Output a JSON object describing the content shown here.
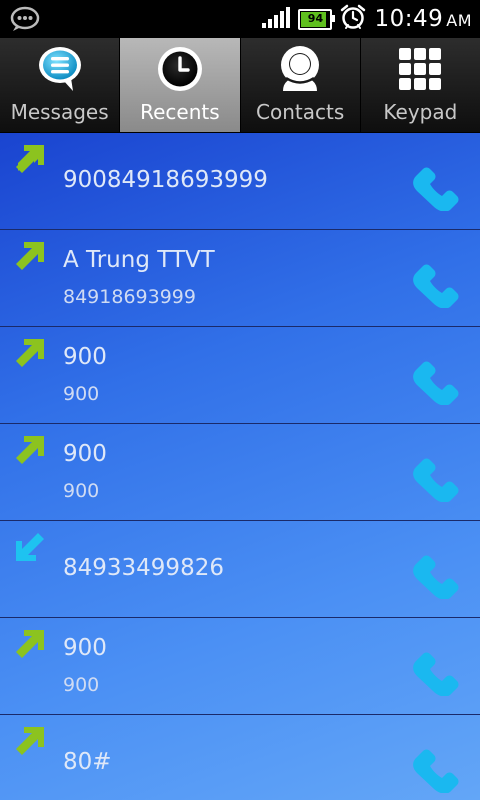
{
  "status_bar": {
    "battery_level": "94",
    "time": "10:49",
    "ampm": "AM",
    "icons": [
      "notification-icon",
      "signal-icon",
      "battery-icon",
      "alarm-icon"
    ]
  },
  "tabs": [
    {
      "label": "Messages",
      "icon": "message-bubble-icon",
      "active": false
    },
    {
      "label": "Recents",
      "icon": "clock-icon",
      "active": true
    },
    {
      "label": "Contacts",
      "icon": "person-icon",
      "active": false
    },
    {
      "label": "Keypad",
      "icon": "keypad-icon",
      "active": false
    }
  ],
  "calls": [
    {
      "direction": "outgoing",
      "name": "90084918693999",
      "number": ""
    },
    {
      "direction": "outgoing",
      "name": "A Trung TTVT",
      "number": "84918693999"
    },
    {
      "direction": "outgoing",
      "name": "900",
      "number": "900"
    },
    {
      "direction": "outgoing",
      "name": "900",
      "number": "900"
    },
    {
      "direction": "incoming",
      "name": "84933499826",
      "number": ""
    },
    {
      "direction": "outgoing",
      "name": "900",
      "number": "900"
    },
    {
      "direction": "outgoing",
      "name": "80#",
      "number": ""
    }
  ],
  "colors": {
    "outgoing_arrow": "#8cc31f",
    "incoming_arrow": "#1ec3f0",
    "call_icon": "#1ab8f0",
    "list_gradient_start": "#1a44d0",
    "list_gradient_end": "#63a6f7"
  }
}
